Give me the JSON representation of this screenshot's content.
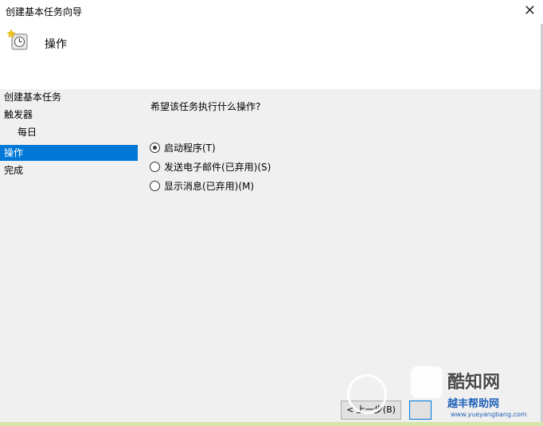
{
  "window": {
    "title": "创建基本任务向导",
    "close_glyph": "✕"
  },
  "header": {
    "title": "操作",
    "icon": "task-clock-icon"
  },
  "sidebar": {
    "items": [
      {
        "label": "创建基本任务",
        "selected": false,
        "indent": false
      },
      {
        "label": "触发器",
        "selected": false,
        "indent": false
      },
      {
        "label": "每日",
        "selected": false,
        "indent": true
      },
      {
        "label": "操作",
        "selected": true,
        "indent": false
      },
      {
        "label": "完成",
        "selected": false,
        "indent": false
      }
    ]
  },
  "main": {
    "question": "希望该任务执行什么操作?",
    "options": [
      {
        "label": "启动程序(T)",
        "checked": true
      },
      {
        "label": "发送电子邮件(已弃用)(S)",
        "checked": false
      },
      {
        "label": "显示消息(已弃用)(M)",
        "checked": false
      }
    ]
  },
  "buttons": {
    "back": "< 上一步(B)",
    "next": ""
  },
  "watermark": {
    "brand": "酷知网",
    "name": "越丰帮助网",
    "url": "www.yueyangbang.com"
  },
  "colors": {
    "selection": "#0078d7",
    "background": "#f0f0f0",
    "header_bg": "#ffffff"
  }
}
